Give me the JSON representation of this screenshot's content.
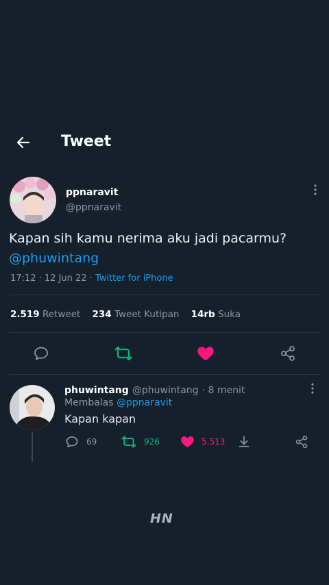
{
  "header": {
    "title": "Tweet"
  },
  "tweet": {
    "display_name": "ppnaravit",
    "handle": "@ppnaravit",
    "text": "Kapan sih kamu nerima aku jadi pacarmu?",
    "mention": "@phuwintang",
    "time": "17:12",
    "separator": "·",
    "date": "12 Jun 22",
    "source": "Twitter for iPhone",
    "stats": {
      "retweets_count": "2.519",
      "retweets_label": "Retweet",
      "quotes_count": "234",
      "quotes_label": "Tweet Kutipan",
      "likes_count": "14rb",
      "likes_label": "Suka"
    }
  },
  "reply": {
    "display_name": "phuwintang",
    "handle": "@phuwintang",
    "time": "· 8 menit",
    "replying_label": "Membalas",
    "replying_to": "@ppnaravit",
    "text": "Kapan kapan",
    "replies": "69",
    "retweets": "926",
    "likes": "5.513"
  },
  "watermark": "HN",
  "colors": {
    "background": "#15202b",
    "accent": "#1d9bf0",
    "retweet": "#00ba7c",
    "like": "#f91880"
  }
}
